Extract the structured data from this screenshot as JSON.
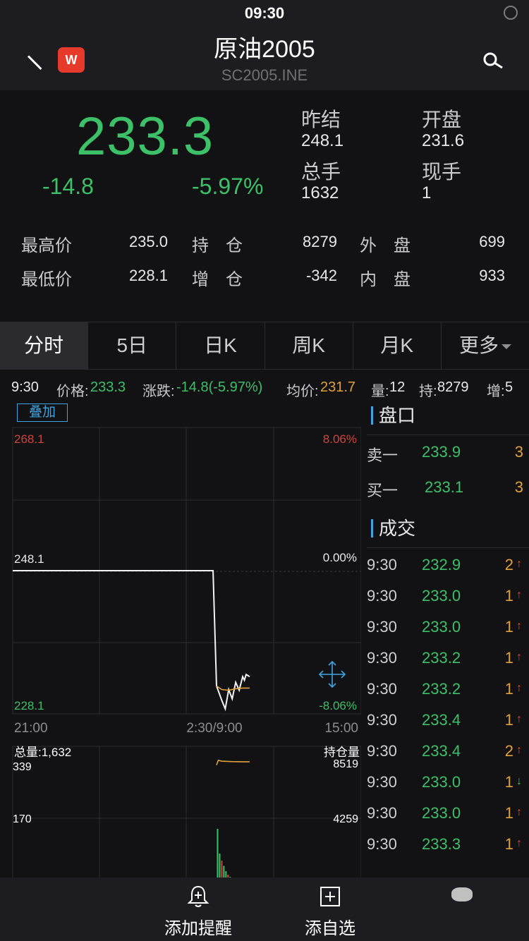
{
  "status": {
    "time": "09:30"
  },
  "header": {
    "logo_text": "W",
    "title": "原油2005",
    "subtitle": "SC2005.INE",
    "back_icon": "back-arrow-icon",
    "search_icon": "search-icon"
  },
  "quote": {
    "price": "233.3",
    "change": "-14.8",
    "change_pct": "-5.97%",
    "fields": [
      {
        "label": "昨结",
        "value": "248.1"
      },
      {
        "label": "开盘",
        "value": "231.6"
      },
      {
        "label": "总手",
        "value": "1632"
      },
      {
        "label": "现手",
        "value": "1"
      }
    ],
    "stats": [
      {
        "label": "最高价",
        "value": "235.0",
        "label2": "持　仓",
        "value2": "8279",
        "label3": "外　盘",
        "value3": "699"
      },
      {
        "label": "最低价",
        "value": "228.1",
        "label2": "增　仓",
        "value2": "-342",
        "label3": "内　盘",
        "value3": "933"
      }
    ],
    "up_color": "#3cc068"
  },
  "tabs": [
    "分时",
    "5日",
    "日K",
    "周K",
    "月K",
    "更多"
  ],
  "info_bar": {
    "time": "9:30",
    "price_label": "价格:",
    "price": "233.3",
    "change_label": "涨跌:",
    "change": "-14.8(-5.97%)",
    "avg_label": "均价:",
    "avg": "231.7",
    "vol_label": "量:",
    "vol": "12",
    "hold_label": "持:",
    "hold": "8279",
    "inc_label": "增:",
    "inc": "5"
  },
  "chart": {
    "overlay_label": "叠加",
    "y_max_label": "268.1",
    "y_mid_label": "248.1",
    "y_min_label": "228.1",
    "pct_max_label": "8.06%",
    "pct_mid_label": "0.00%",
    "pct_min_label": "-8.06%",
    "x_labels": [
      "21:00",
      "2:30/9:00",
      "15:00"
    ],
    "vol_title": "总量:1,632",
    "vol_max": "339",
    "vol_mid": "170",
    "oi_title": "持仓量",
    "oi_max": "8519",
    "oi_mid": "4259"
  },
  "chart_data": {
    "type": "line",
    "ylim": [
      228.1,
      268.1
    ],
    "x_range": [
      "21:00",
      "15:00"
    ],
    "series": [
      {
        "name": "价格",
        "points": [
          [
            0,
            248.1
          ],
          [
            0.575,
            248.1
          ],
          [
            0.585,
            232
          ],
          [
            0.6,
            230
          ],
          [
            0.61,
            228.8
          ],
          [
            0.62,
            231.5
          ],
          [
            0.63,
            230.2
          ],
          [
            0.64,
            232.5
          ],
          [
            0.65,
            231.4
          ],
          [
            0.66,
            233.3
          ],
          [
            0.665,
            232.8
          ],
          [
            0.67,
            233.6
          ],
          [
            0.68,
            233.3
          ]
        ]
      },
      {
        "name": "均价",
        "points": [
          [
            0.585,
            232
          ],
          [
            0.6,
            231.5
          ],
          [
            0.62,
            231.4
          ],
          [
            0.64,
            231.6
          ],
          [
            0.66,
            231.7
          ],
          [
            0.68,
            231.7
          ]
        ]
      }
    ],
    "open_interest_points": [
      [
        0.585,
        8050
      ],
      [
        0.59,
        8380
      ],
      [
        0.6,
        8320
      ],
      [
        0.63,
        8290
      ],
      [
        0.66,
        8280
      ],
      [
        0.68,
        8279
      ]
    ]
  },
  "orderbook": {
    "title": "盘口",
    "rows": [
      {
        "label": "卖一",
        "price": "233.9",
        "qty": "3"
      },
      {
        "label": "买一",
        "price": "233.1",
        "qty": "3"
      }
    ]
  },
  "trades": {
    "title": "成交",
    "rows": [
      {
        "time": "9:30",
        "price": "232.9",
        "qty": "2",
        "dir": "up"
      },
      {
        "time": "9:30",
        "price": "233.0",
        "qty": "1",
        "dir": "up"
      },
      {
        "time": "9:30",
        "price": "233.0",
        "qty": "1",
        "dir": "up"
      },
      {
        "time": "9:30",
        "price": "233.2",
        "qty": "1",
        "dir": "up"
      },
      {
        "time": "9:30",
        "price": "233.2",
        "qty": "1",
        "dir": "up"
      },
      {
        "time": "9:30",
        "price": "233.4",
        "qty": "1",
        "dir": "up"
      },
      {
        "time": "9:30",
        "price": "233.4",
        "qty": "2",
        "dir": "up"
      },
      {
        "time": "9:30",
        "price": "233.0",
        "qty": "1",
        "dir": "down"
      },
      {
        "time": "9:30",
        "price": "233.0",
        "qty": "1",
        "dir": "up"
      },
      {
        "time": "9:30",
        "price": "233.3",
        "qty": "1",
        "dir": "up"
      }
    ]
  },
  "bottom_bar": {
    "alert_label": "添加提醒",
    "alert_icon": "bell-plus-icon",
    "watch_label": "添自选",
    "watch_icon": "plus-square-icon"
  }
}
